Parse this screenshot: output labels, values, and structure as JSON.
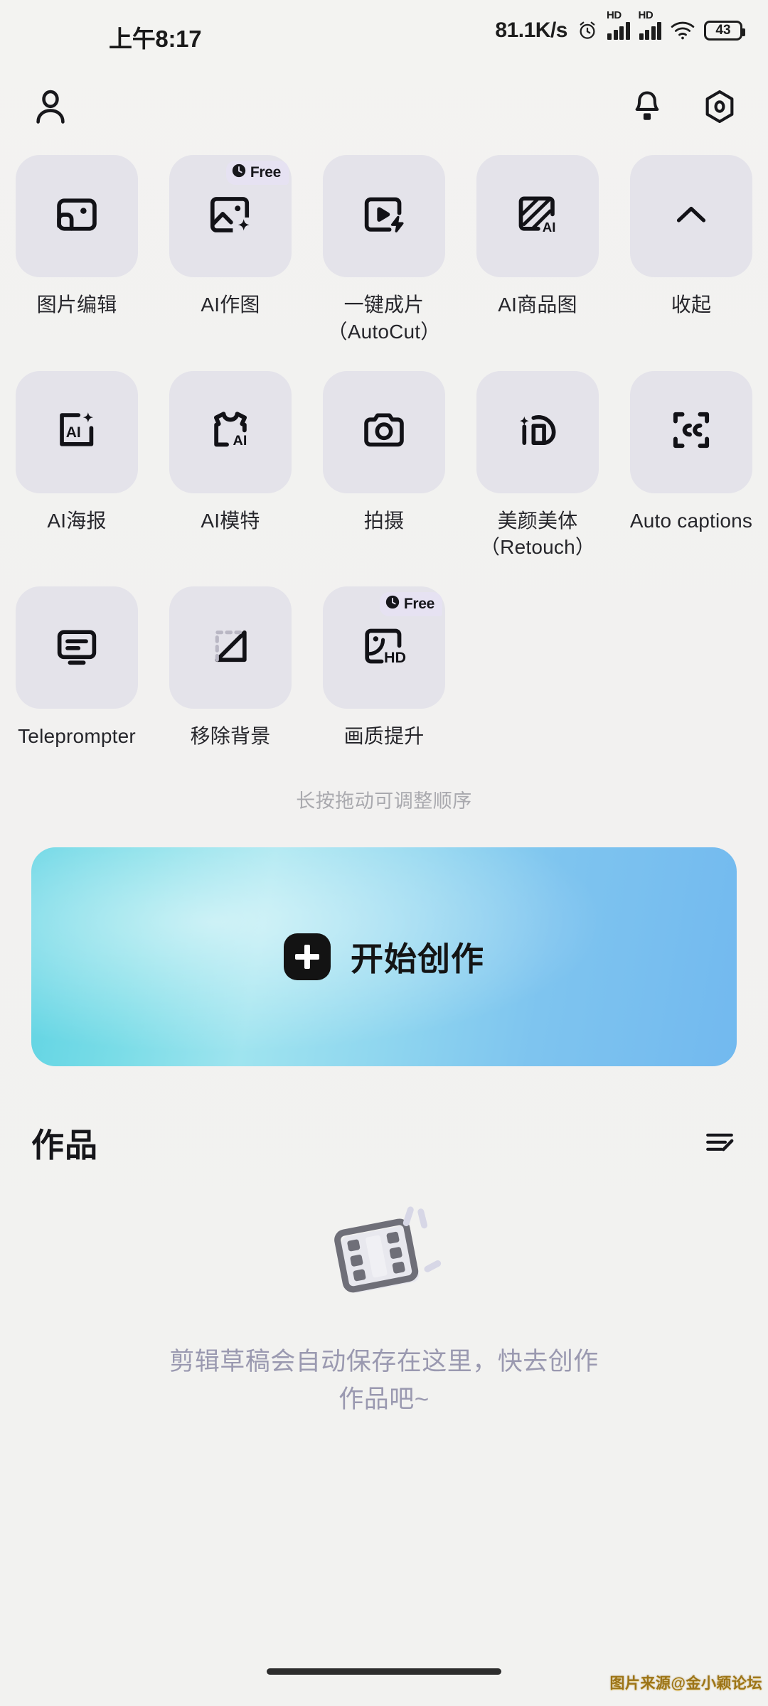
{
  "status_bar": {
    "time": "上午8:17",
    "net_speed": "81.1K/s",
    "alarm_icon": "alarm-clock-icon",
    "hd_label_1": "HD",
    "hd_label_2": "HD",
    "wifi_icon": "wifi-icon",
    "battery_level": "43"
  },
  "app_bar": {
    "profile_icon": "person-icon",
    "notification_icon": "bell-icon",
    "settings_icon": "settings-hexagon-icon"
  },
  "tools": {
    "hint": "长按拖动可调整顺序",
    "badge_free_label": "Free",
    "items": [
      {
        "label": "图片编辑",
        "icon": "image-edit-icon",
        "badge": null
      },
      {
        "label": "AI作图",
        "icon": "ai-image-sparkle-icon",
        "badge": "Free"
      },
      {
        "label": "一键成片\n（AutoCut）",
        "icon": "autocut-play-bolt-icon",
        "badge": null
      },
      {
        "label": "AI商品图",
        "icon": "ai-product-image-icon",
        "badge": null
      },
      {
        "label": "收起",
        "icon": "chevron-up-icon",
        "badge": null
      },
      {
        "label": "AI海报",
        "icon": "ai-poster-icon",
        "badge": null
      },
      {
        "label": "AI模特",
        "icon": "ai-model-tshirt-icon",
        "badge": null
      },
      {
        "label": "拍摄",
        "icon": "camera-icon",
        "badge": null
      },
      {
        "label": "美颜美体\n（Retouch）",
        "icon": "retouch-face-icon",
        "badge": null
      },
      {
        "label": "Auto captions",
        "icon": "captions-cc-icon",
        "badge": null
      },
      {
        "label": "Teleprompter",
        "icon": "teleprompter-screen-icon",
        "badge": null
      },
      {
        "label": "移除背景",
        "icon": "remove-background-icon",
        "badge": null
      },
      {
        "label": "画质提升",
        "icon": "hd-enhance-icon",
        "badge": "Free"
      }
    ]
  },
  "create_banner": {
    "label": "开始创作",
    "plus_icon": "plus-icon",
    "gradient_from": "#5ed3e3",
    "gradient_to": "#72b9ef"
  },
  "works": {
    "title": "作品",
    "manage_icon": "edit-list-icon",
    "empty_icon": "film-strip-icon",
    "empty_text": "剪辑草稿会自动保存在这里，快去创作\n作品吧~"
  },
  "system": {
    "home_indicator": "home-indicator",
    "watermark": "图片来源@金小颖论坛"
  }
}
